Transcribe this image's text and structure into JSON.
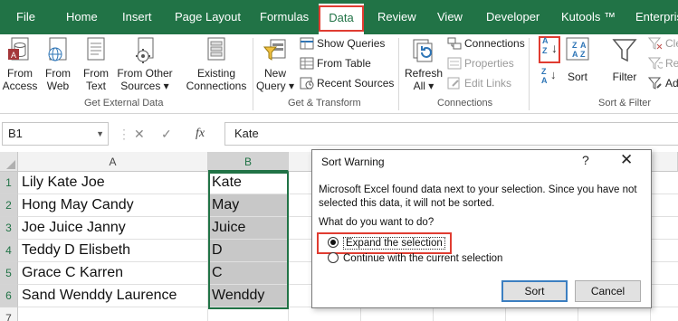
{
  "ribbon_tabs": [
    {
      "label": "File"
    },
    {
      "label": "Home"
    },
    {
      "label": "Insert"
    },
    {
      "label": "Page Layout"
    },
    {
      "label": "Formulas"
    },
    {
      "label": "Data"
    },
    {
      "label": "Review"
    },
    {
      "label": "View"
    },
    {
      "label": "Developer"
    },
    {
      "label": "Kutools ™"
    },
    {
      "label": "Enterprise"
    }
  ],
  "get_external_data": {
    "group_label": "Get External Data",
    "buttons": [
      {
        "line1": "From",
        "line2": "Access"
      },
      {
        "line1": "From",
        "line2": "Web"
      },
      {
        "line1": "From",
        "line2": "Text"
      },
      {
        "line1": "From Other",
        "line2": "Sources ▾"
      },
      {
        "line1": "Existing",
        "line2": "Connections"
      }
    ]
  },
  "get_transform": {
    "group_label": "Get & Transform",
    "new_query": {
      "line1": "New",
      "line2": "Query ▾"
    },
    "small": [
      "Show Queries",
      "From Table",
      "Recent Sources"
    ]
  },
  "connections": {
    "group_label": "Connections",
    "refresh_all": {
      "line1": "Refresh",
      "line2": "All ▾"
    },
    "small": [
      "Connections",
      "Properties",
      "Edit Links"
    ]
  },
  "sort_filter": {
    "group_label": "Sort & Filter",
    "az_label": "A Z",
    "za_label": "Z A",
    "sort_label": "Sort",
    "filter_label": "Filter",
    "small": [
      "Cle",
      "Rea",
      "Adv"
    ]
  },
  "formula_bar": {
    "name_box": "B1",
    "cancel_symbol": "✕",
    "enter_symbol": "✓",
    "fx_symbol": "fx",
    "formula": "Kate"
  },
  "sheet": {
    "columns": [
      "A",
      "B"
    ],
    "rows": [
      {
        "num": "1",
        "a": "Lily Kate Joe",
        "b": "Kate"
      },
      {
        "num": "2",
        "a": "Hong May Candy",
        "b": "May"
      },
      {
        "num": "3",
        "a": "Joe Juice Janny",
        "b": "Juice"
      },
      {
        "num": "4",
        "a": "Teddy D Elisbeth",
        "b": "D"
      },
      {
        "num": "5",
        "a": "Grace C Karren",
        "b": "C"
      },
      {
        "num": "6",
        "a": "Sand Wenddy Laurence",
        "b": "Wenddy"
      },
      {
        "num": "7",
        "a": "",
        "b": ""
      }
    ]
  },
  "dialog": {
    "title": "Sort Warning",
    "help": "?",
    "close": "✕",
    "message": "Microsoft Excel found data next to your selection.  Since you have not selected this data, it will not be sorted.",
    "question": "What do you want to do?",
    "options": [
      {
        "label": "Expand the selection",
        "selected": true
      },
      {
        "label": "Continue with the current selection",
        "selected": false
      }
    ],
    "sort_button": "Sort",
    "cancel_button": "Cancel"
  },
  "colors": {
    "ribbon_green": "#217346",
    "highlight_red": "#e03c31",
    "selection_green": "#217346"
  }
}
